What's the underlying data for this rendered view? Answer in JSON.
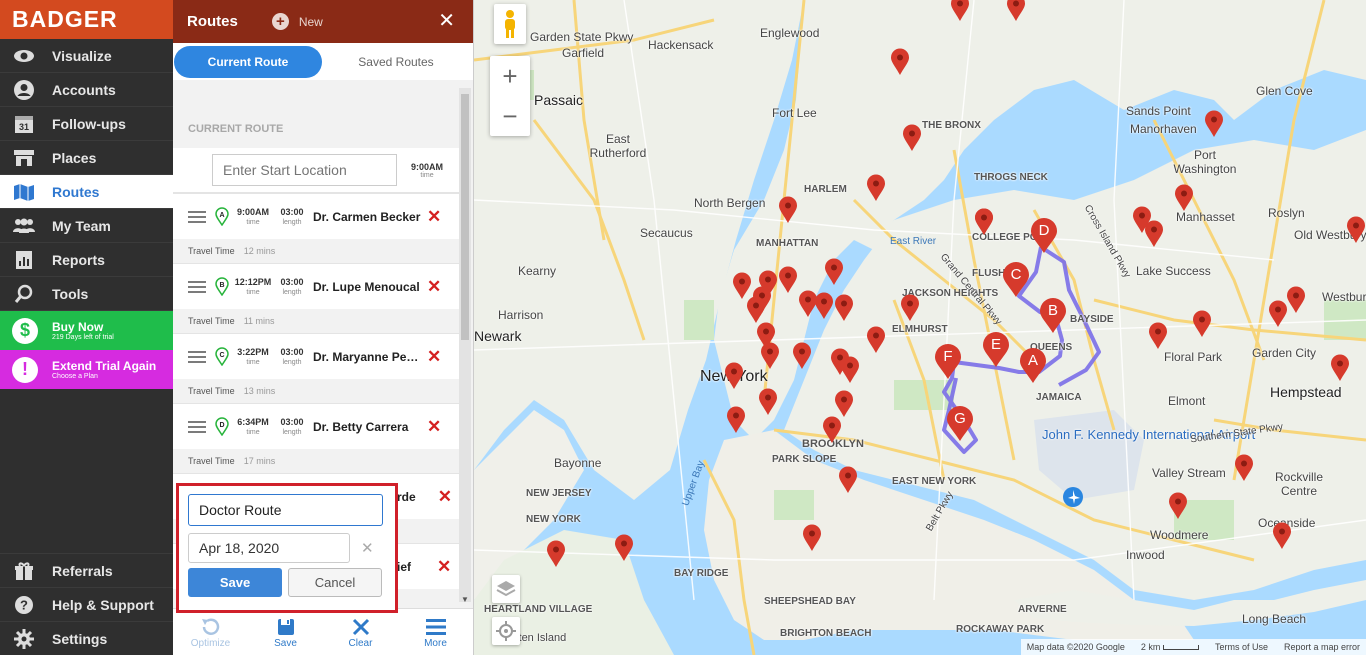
{
  "app": {
    "logo": "BADGER"
  },
  "nav": {
    "items": [
      {
        "label": "Visualize",
        "icon": "eye-icon"
      },
      {
        "label": "Accounts",
        "icon": "user-icon"
      },
      {
        "label": "Follow-ups",
        "icon": "calendar-icon",
        "icon_text": "31"
      },
      {
        "label": "Places",
        "icon": "store-icon"
      },
      {
        "label": "Routes",
        "icon": "map-icon"
      },
      {
        "label": "My Team",
        "icon": "team-icon"
      },
      {
        "label": "Reports",
        "icon": "reports-icon"
      },
      {
        "label": "Tools",
        "icon": "tools-icon"
      }
    ],
    "active": "Routes",
    "buy_now": {
      "title": "Buy Now",
      "subtitle": "219 Days left of trial",
      "icon_text": "$"
    },
    "extend_trial": {
      "title": "Extend Trial Again",
      "subtitle": "Choose a Plan",
      "icon_text": "!"
    },
    "bottom_items": [
      {
        "label": "Referrals",
        "icon": "gift-icon"
      },
      {
        "label": "Help & Support",
        "icon": "help-icon"
      },
      {
        "label": "Settings",
        "icon": "gear-icon"
      }
    ]
  },
  "panel": {
    "title": "Routes",
    "new_label": "New",
    "tabs": [
      {
        "label": "Current Route"
      },
      {
        "label": "Saved Routes"
      }
    ],
    "section_label": "CURRENT ROUTE",
    "start": {
      "placeholder": "Enter Start Location",
      "time": "9:00AM",
      "time_label": "time"
    },
    "stops": [
      {
        "letter": "A",
        "time": "9:00AM",
        "length": "03:00",
        "name": "Dr. Carmen Becker",
        "travel_label": "Travel Time",
        "travel": "12 mins"
      },
      {
        "letter": "B",
        "time": "12:12PM",
        "length": "03:00",
        "name": "Dr. Lupe Menoucal",
        "travel_label": "Travel Time",
        "travel": "11 mins"
      },
      {
        "letter": "C",
        "time": "3:22PM",
        "length": "03:00",
        "name": "Dr. Maryanne Peterson",
        "travel_label": "Travel Time",
        "travel": "13 mins"
      },
      {
        "letter": "D",
        "time": "6:34PM",
        "length": "03:00",
        "name": "Dr. Betty Carrera",
        "travel_label": "Travel Time",
        "travel": "17 mins"
      }
    ],
    "time_sub": "time",
    "length_sub": "length",
    "hidden_fragments": [
      "rde",
      "ief"
    ],
    "toolbar": [
      {
        "label": "Optimize",
        "icon": "optimize-icon"
      },
      {
        "label": "Save",
        "icon": "save-icon"
      },
      {
        "label": "Clear",
        "icon": "clear-icon"
      },
      {
        "label": "More",
        "icon": "menu-icon"
      }
    ]
  },
  "save_popup": {
    "route_name": "Doctor Route",
    "date": "Apr 18, 2020",
    "save_label": "Save",
    "cancel_label": "Cancel"
  },
  "map": {
    "labels": [
      "Garden State Pkwy",
      "Hackensack",
      "Englewood",
      "Garfield",
      "Passaic",
      "Fort Lee",
      "East Rutherford",
      "North Bergen",
      "Secaucus",
      "Kearny",
      "Harrison",
      "Newark",
      "HARLEM",
      "MANHATTAN",
      "THE BRONX",
      "THROGS NECK",
      "COLLEGE POINT",
      "FLUSHING",
      "JACKSON HEIGHTS",
      "ELMHURST",
      "QUEENS",
      "BAYSIDE",
      "JAMAICA",
      "New York",
      "BROOKLYN",
      "PARK SLOPE",
      "Bayonne",
      "NEW JERSEY",
      "NEW YORK",
      "EAST NEW YORK",
      "SHEEPSHEAD BAY",
      "BRIGHTON BEACH",
      "ROCKAWAY PARK",
      "ARVERNE",
      "Sands Point",
      "Manorhaven",
      "Port Washington",
      "Manhasset",
      "Roslyn",
      "Glen Cove",
      "Old Westbury",
      "Lake Success",
      "Floral Park",
      "Garden City",
      "Westbury",
      "Hempstead",
      "Elmont",
      "Valley Stream",
      "Rockville Centre",
      "Oceanside",
      "Woodmere",
      "Inwood",
      "Long Beach",
      "HEARTLAND VILLAGE",
      "BAY RIDGE",
      "John F. Kennedy International Airport",
      "East River",
      "Upper Bay",
      "Southern State Pkwy",
      "Belt Pkwy",
      "Grand Central Pkwy",
      "Cross Island Pkwy",
      "Staten Island"
    ],
    "route_pins": [
      "A",
      "B",
      "C",
      "D",
      "E",
      "F",
      "G"
    ],
    "attribution": {
      "data": "Map data ©2020 Google",
      "scale": "2 km",
      "terms": "Terms of Use",
      "report": "Report a map error"
    },
    "zoom_in": "+",
    "zoom_out": "−"
  },
  "colors": {
    "logo_bg": "#d34a1f",
    "panel_header": "#8a2a16",
    "active_nav": "#2f78d0",
    "buy_now": "#1fbd4b",
    "extend_trial": "#d62be0",
    "delete_x": "#d42020",
    "pin_red": "#d63a2c",
    "route_line": "#7a6ee8",
    "highlight_border": "#d0202a"
  }
}
